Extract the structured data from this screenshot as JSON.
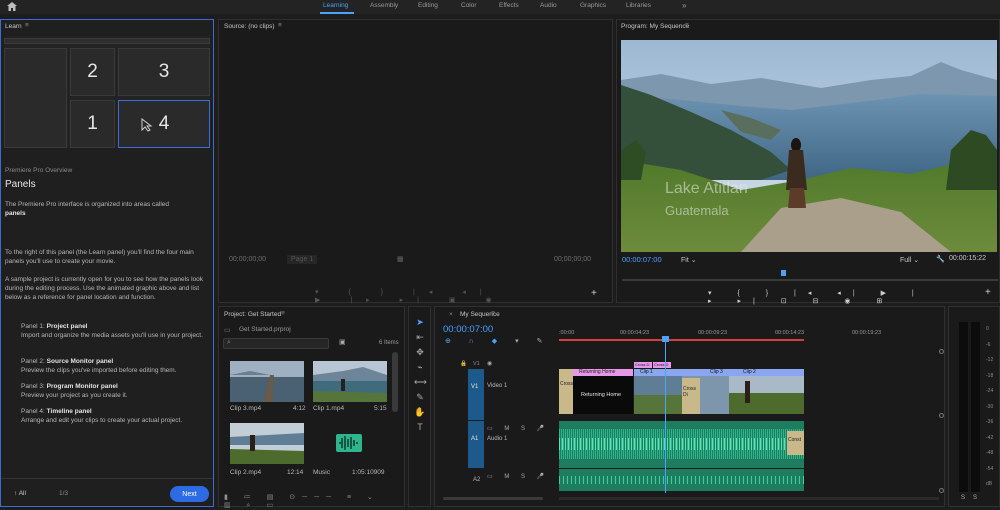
{
  "workspaces": [
    "Learning",
    "Assembly",
    "Editing",
    "Color",
    "Effects",
    "Audio",
    "Graphics",
    "Libraries"
  ],
  "more_glyph": "»",
  "learn": {
    "title": "Learn",
    "menu_glyph": "≡",
    "grid_numbers": [
      "2",
      "3",
      "1",
      "4"
    ],
    "section": "Premiere Pro Overview",
    "heading": "Panels",
    "p1": "The Premiere Pro interface is organized into areas called",
    "p1b": "panels",
    "p2": "To the right of this panel (the Learn panel) you'll find the four main panels you'll use to create your movie.",
    "p3": "A sample project is currently open for you to see how the panels look during the editing process. Use the animated graphic above and list below as a reference for panel location and function.",
    "items": [
      {
        "prefix": "Panel 1:",
        "name": "Project panel",
        "desc": "Import and organize the media assets you'll use in your project."
      },
      {
        "prefix": "Panel 2:",
        "name": "Source Monitor panel",
        "desc": "Preview the clips you've imported before editing them."
      },
      {
        "prefix": "Panel 3:",
        "name": "Program Monitor panel",
        "desc": "Preview your project as you create it."
      },
      {
        "prefix": "Panel 4:",
        "name": "Timeline panel",
        "desc": "Arrange and edit your clips to create your actual project."
      }
    ],
    "all_label": "All",
    "page": "1/3",
    "next": "Next"
  },
  "source": {
    "title": "Source: (no clips)",
    "tc_left": "00;00;00;00",
    "page_field": "Page 1",
    "tc_right": "00;00;00;00"
  },
  "program": {
    "title": "Program: My Sequence",
    "overlay_line1": "Lake Atitlan",
    "overlay_line2": "Guatemala",
    "tc_left": "00:00:07:00",
    "fit": "Fit",
    "quality": "Full",
    "tc_right": "00:00:15:22"
  },
  "project": {
    "title": "Project: Get Started",
    "file": "Get Started.prproj",
    "count": "6 Items",
    "clips": [
      {
        "name": "Clip 3.mp4",
        "dur": "4:12"
      },
      {
        "name": "Clip 1.mp4",
        "dur": "5:15"
      },
      {
        "name": "Clip 2.mp4",
        "dur": "12:14"
      },
      {
        "name": "Music",
        "dur": "1:05:10909"
      }
    ]
  },
  "timeline": {
    "title": "My Sequence",
    "timecode": "00:00:07:00",
    "ruler": [
      ":00:00",
      "00:00:04:23",
      "00:00:09:23",
      "00:00:14:23",
      "00:00:19:23"
    ],
    "tracks": {
      "v1": "V1",
      "video1": "Video 1",
      "a1": "A1",
      "audio1": "Audio 1",
      "a2": "A2"
    },
    "clips": {
      "returning_home_fx": "Returning Home",
      "returning_home_title": "Returning Home",
      "clip1": "Clip 1",
      "clip2": "Clip 2",
      "clip3": "Clip 3",
      "cross_dissolve_a": "Cross D",
      "cross_dissolve_b": "Cross Di",
      "cross_label": "Cross",
      "const": "Const"
    }
  },
  "meter": {
    "labels": [
      "0",
      "-6",
      "-12",
      "-18",
      "-24",
      "-30",
      "-36",
      "-42",
      "-48",
      "-54",
      "dB"
    ],
    "solo": "S"
  },
  "colors": {
    "accent": "#2d6be4",
    "timecode": "#4aa3ff",
    "audio_wave": "#2fb58c",
    "title_clip": "#e597e8",
    "video_clip": "#8aa6f0"
  }
}
